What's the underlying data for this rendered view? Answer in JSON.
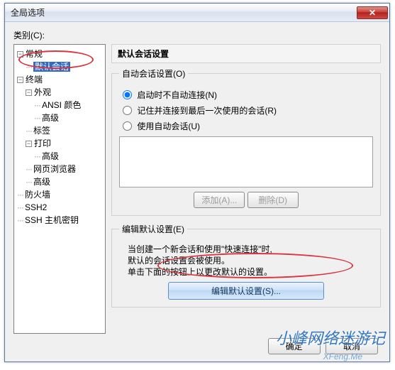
{
  "window": {
    "title": "全局选项"
  },
  "category_label": "类别(C):",
  "tree": {
    "n_general": "常规",
    "n_default_session": "默认会话",
    "n_terminal": "终端",
    "n_appearance": "外观",
    "n_ansi_color": "ANSI 颜色",
    "n_advanced1": "高级",
    "n_tabs": "标签",
    "n_print": "打印",
    "n_advanced2": "高级",
    "n_web_browser": "网页浏览器",
    "n_advanced3": "高级",
    "n_firewall": "防火墙",
    "n_ssh2": "SSH2",
    "n_ssh_host_keys": "SSH 主机密钥"
  },
  "panel": {
    "title": "默认会话设置",
    "auto_legend": "自动会话设置(O)",
    "radio_no_auto": "启动时不自动连接(N)",
    "radio_remember_last": "记住并连接到最后一次使用的会话(R)",
    "radio_use_auto": "使用自动会话(U)",
    "btn_add": "添加(A)...",
    "btn_delete": "删除(D)",
    "edit_legend": "编辑默认设置(E)",
    "desc_line1": "当创建一个新会话和使用\"快速连接\"时,",
    "desc_line2": "默认的会话设置会被使用。",
    "desc_line3": "单击下面的按钮上以更改默认的设置。",
    "btn_edit_default": "编辑默认设置(S)..."
  },
  "footer": {
    "ok": "确定",
    "cancel": "取消"
  },
  "watermark": {
    "main": "小峰网络迷游记",
    "sub": "XFeng.Me"
  }
}
